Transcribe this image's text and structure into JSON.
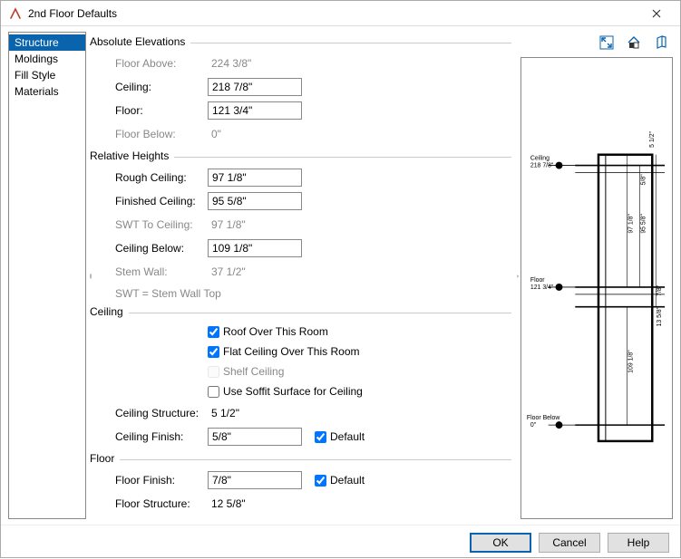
{
  "window": {
    "title": "2nd Floor Defaults"
  },
  "sidebar": {
    "items": [
      {
        "label": "Structure",
        "selected": true
      },
      {
        "label": "Moldings"
      },
      {
        "label": "Fill Style"
      },
      {
        "label": "Materials"
      }
    ]
  },
  "abs": {
    "head": "Absolute Elevations",
    "floor_above_lbl": "Floor Above:",
    "floor_above_val": "224 3/8\"",
    "ceiling_lbl": "Ceiling:",
    "ceiling_val": "218 7/8\"",
    "floor_lbl": "Floor:",
    "floor_val": "121 3/4\"",
    "floor_below_lbl": "Floor Below:",
    "floor_below_val": "0\""
  },
  "rel": {
    "head": "Relative Heights",
    "rough_ceil_lbl": "Rough Ceiling:",
    "rough_ceil_val": "97 1/8\"",
    "fin_ceil_lbl": "Finished Ceiling:",
    "fin_ceil_val": "95 5/8\"",
    "swt_lbl": "SWT To Ceiling:",
    "swt_val": "97 1/8\"",
    "ceil_below_lbl": "Ceiling Below:",
    "ceil_below_val": "109 1/8\"",
    "stem_lbl": "Stem Wall:",
    "stem_val": "37 1/2\"",
    "note": "SWT = Stem Wall Top"
  },
  "ceiling": {
    "head": "Ceiling",
    "roof_over": "Roof Over This Room",
    "flat_ceil": "Flat Ceiling Over This Room",
    "shelf": "Shelf Ceiling",
    "soffit": "Use Soffit Surface for Ceiling",
    "struct_lbl": "Ceiling Structure:",
    "struct_val": "5 1/2\"",
    "finish_lbl": "Ceiling Finish:",
    "finish_val": "5/8\"",
    "default_lbl": "Default"
  },
  "floor": {
    "head": "Floor",
    "finish_lbl": "Floor Finish:",
    "finish_val": "7/8\"",
    "default_lbl": "Default",
    "struct_lbl": "Floor Structure:",
    "struct_val": "12 5/8\""
  },
  "preview": {
    "ceiling_lbl": "Ceiling",
    "ceiling_val": "218 7/8\"",
    "floor_lbl": "Floor",
    "floor_val": "121 3/4\"",
    "floor_below_lbl": "Floor Below",
    "floor_below_val": "0\"",
    "d1": "5 1/2\"",
    "d2": "5/8\"",
    "d3": "95 5/8\"",
    "d4": "97 1/8\"",
    "d5": "13 5/8\"",
    "d6": "7/8\"",
    "d7": "109 1/8\""
  },
  "buttons": {
    "ok": "OK",
    "cancel": "Cancel",
    "help": "Help"
  }
}
